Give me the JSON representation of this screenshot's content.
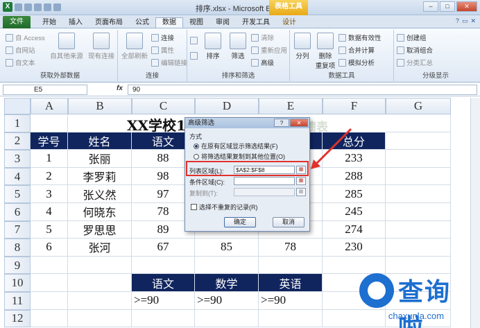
{
  "window": {
    "title": "排序.xlsx - Microsoft Excel",
    "context_tab": "表格工具",
    "qat_icons": [
      "excel-icon",
      "save-icon",
      "undo-icon",
      "redo-icon",
      "print-icon",
      "customize-icon"
    ],
    "buttons": [
      "–",
      "□",
      "✕"
    ]
  },
  "tabs": {
    "file": "文件",
    "items": [
      "开始",
      "插入",
      "页面布局",
      "公式",
      "数据",
      "视图",
      "审阅",
      "开发工具",
      "设计"
    ],
    "active": "数据"
  },
  "ribbon": {
    "get_external": {
      "label": "获取外部数据",
      "access": "自 Access",
      "web": "自网站",
      "text": "自文本",
      "other": "自其他来源",
      "existing": "现有连接"
    },
    "connections": {
      "label": "连接",
      "refresh_all": "全部刷新",
      "connections": "连接",
      "properties": "属性",
      "edit_links": "编辑链接"
    },
    "sort_filter": {
      "label": "排序和筛选",
      "sort": "排序",
      "filter": "筛选",
      "clear": "清除",
      "reapply": "重新应用",
      "advanced": "高级"
    },
    "data_tools": {
      "label": "数据工具",
      "text_to_columns": "分列",
      "remove_dup": "删除\n重复项",
      "validation": "数据有效性",
      "consolidate": "合并计算",
      "what_if": "模拟分析"
    },
    "outline": {
      "label": "分级显示",
      "group": "创建组",
      "ungroup": "取消组合",
      "subtotal": "分类汇总"
    }
  },
  "formula_bar": {
    "name_box": "E5",
    "fx": "fx",
    "value": "90"
  },
  "sheet": {
    "columns": [
      "A",
      "B",
      "C",
      "D",
      "E",
      "F",
      "G"
    ],
    "rows": [
      "1",
      "2",
      "3",
      "4",
      "5",
      "6",
      "7",
      "8",
      "9",
      "10",
      "11",
      "12"
    ],
    "title": "XX学校1",
    "title_faded": "学生成绩表",
    "header": [
      "学号",
      "姓名",
      "语文",
      "",
      "",
      "总分"
    ],
    "data": [
      [
        "1",
        "张丽",
        "88",
        "",
        "",
        "233"
      ],
      [
        "2",
        "李罗莉",
        "98",
        "",
        "",
        "288"
      ],
      [
        "3",
        "张义然",
        "97",
        "",
        "",
        "285"
      ],
      [
        "4",
        "何晓东",
        "78",
        "",
        "",
        "245"
      ],
      [
        "5",
        "罗思思",
        "89",
        "",
        "",
        "274"
      ],
      [
        "6",
        "张河",
        "67",
        "85",
        "78",
        "230"
      ]
    ],
    "criteria_header": [
      "语文",
      "数学",
      "英语"
    ],
    "criteria_values": [
      ">=90",
      ">=90",
      ">=90"
    ]
  },
  "dialog": {
    "title": "高级筛选",
    "help": "?",
    "close": "✕",
    "mode_label": "方式",
    "option_in_place": "在原有区域显示筛选结果(F)",
    "option_copy": "将筛选结果复制到其他位置(O)",
    "list_range_label": "列表区域(L):",
    "list_range_value": "$A$2:$F$8",
    "criteria_range_label": "条件区域(C):",
    "criteria_range_value": "",
    "copy_to_label": "复制到(T):",
    "copy_to_value": "",
    "unique_label": "选择不重复的记录(R)",
    "ok": "确定",
    "cancel": "取消"
  },
  "watermark": {
    "brand": "查询啦",
    "url": "chaxunla.com"
  },
  "colors": {
    "header_fill": "#10255e",
    "highlight": "#e0312b",
    "brand_blue": "#1d6fd0"
  }
}
